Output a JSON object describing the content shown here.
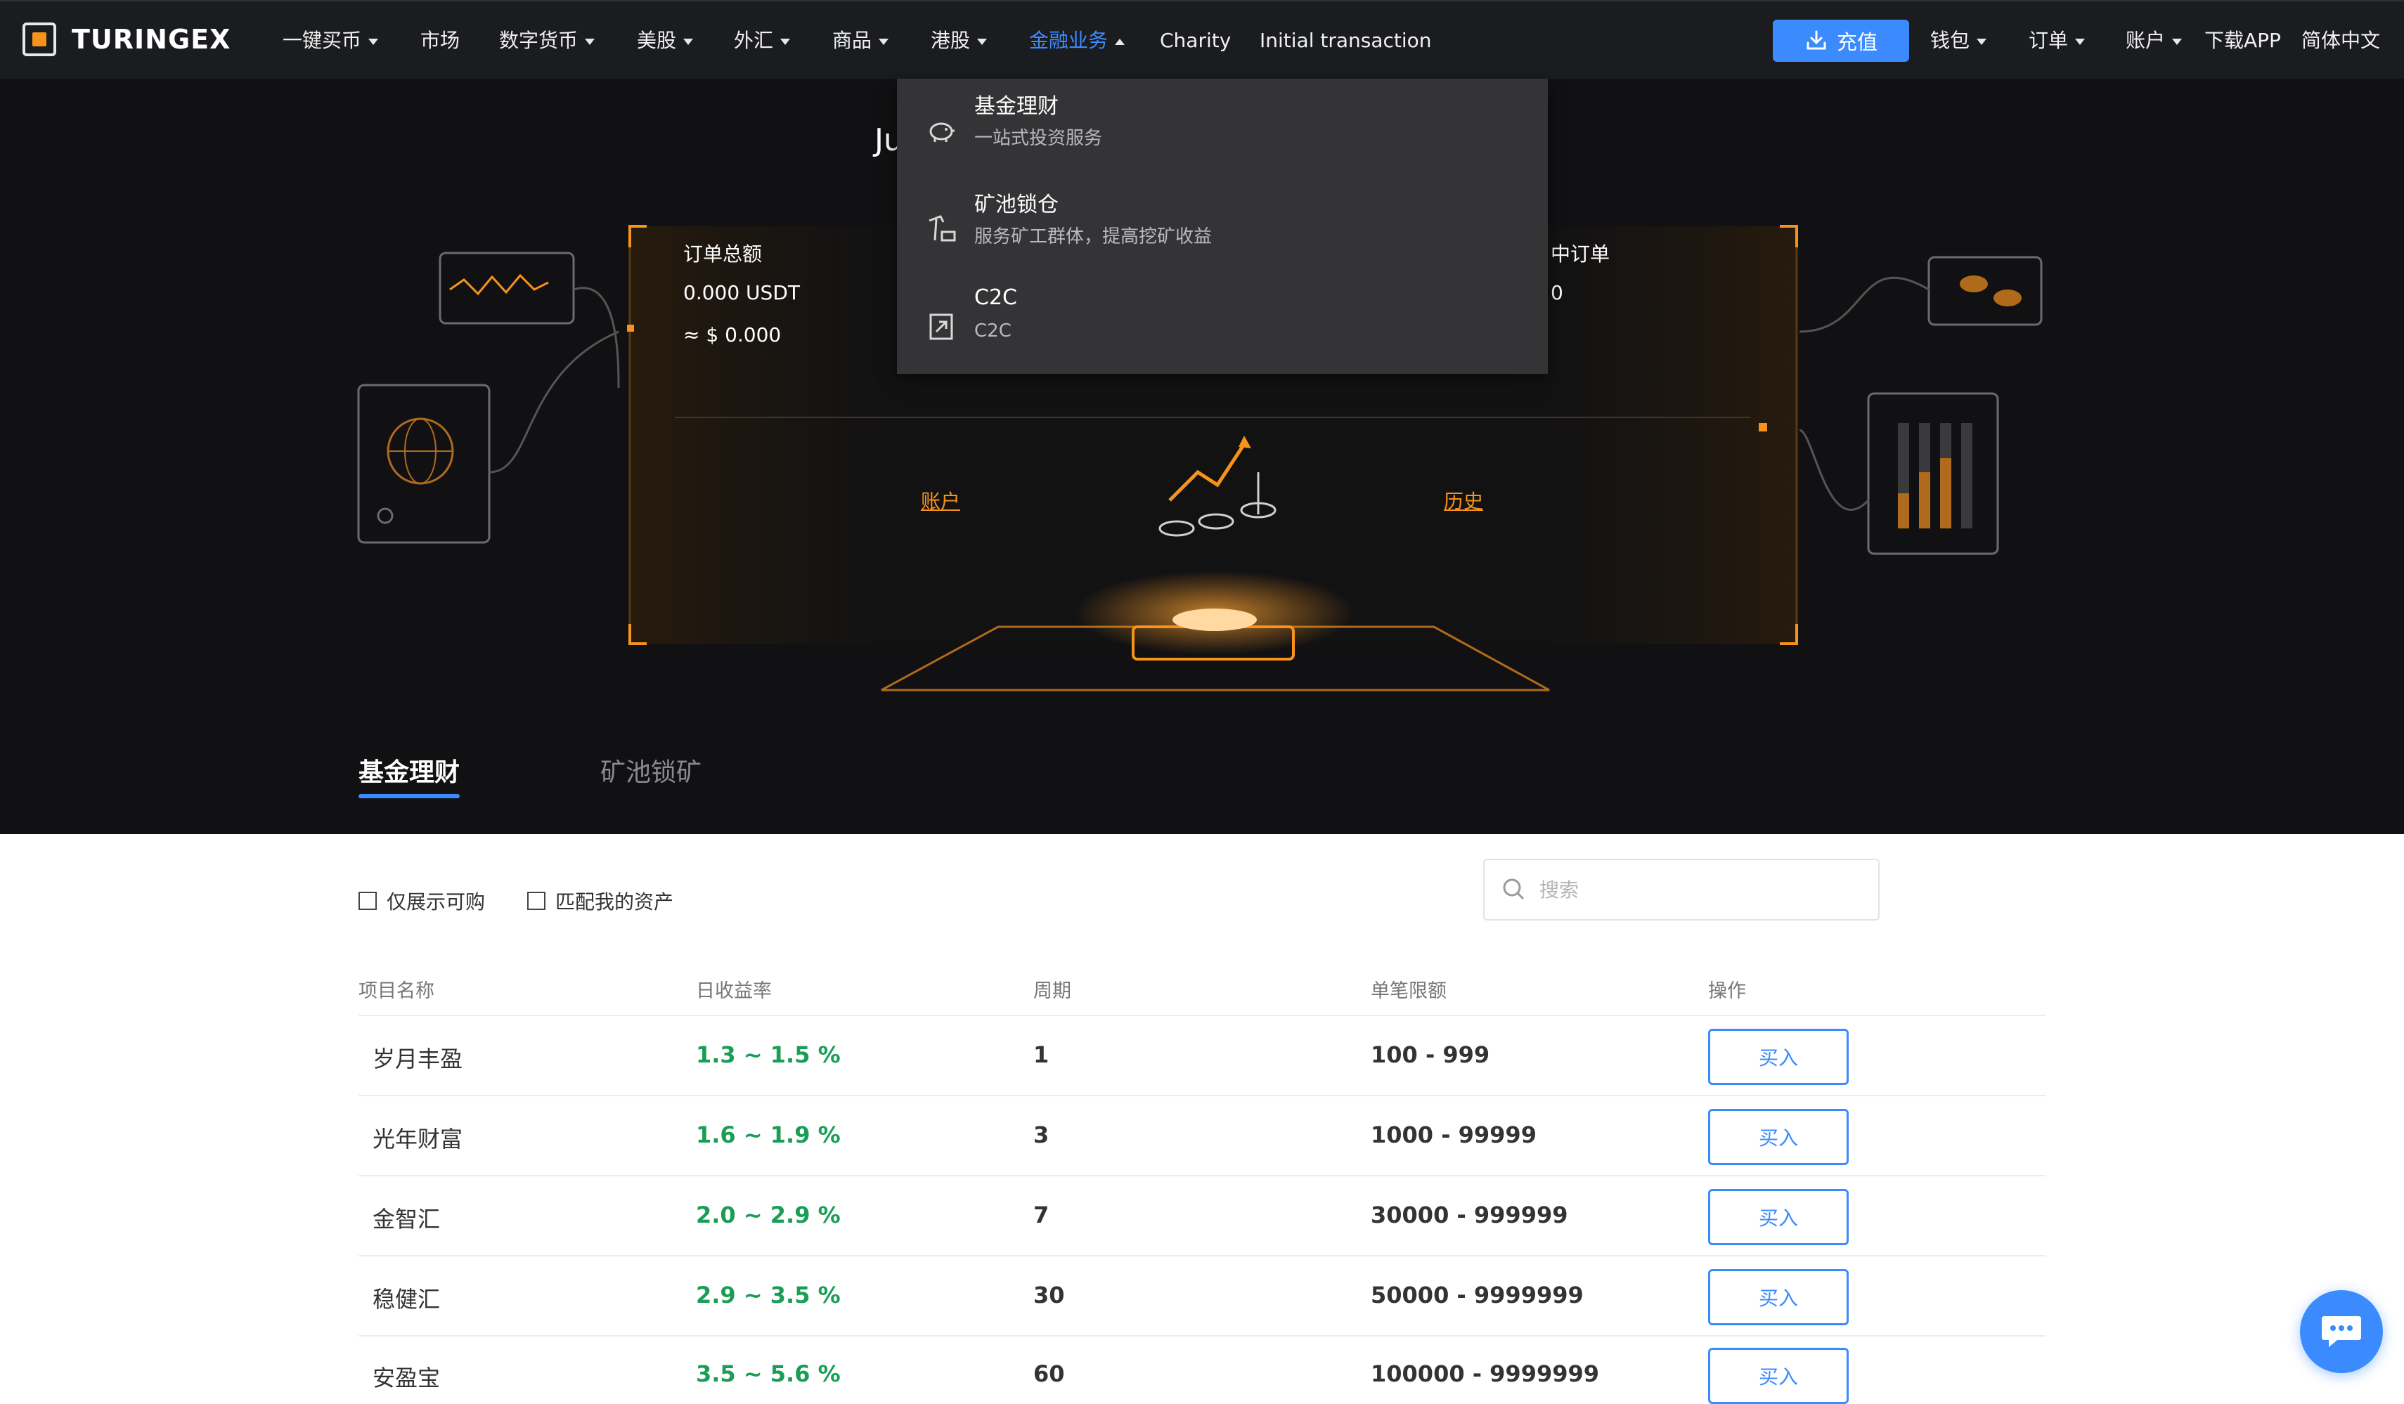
{
  "brand": {
    "name": "TURINGEX"
  },
  "nav": {
    "items": [
      {
        "label": "一键买币",
        "caret": true
      },
      {
        "label": "市场",
        "caret": false
      },
      {
        "label": "数字货币",
        "caret": true
      },
      {
        "label": "美股",
        "caret": true
      },
      {
        "label": "外汇",
        "caret": true
      },
      {
        "label": "商品",
        "caret": true
      },
      {
        "label": "港股",
        "caret": true
      },
      {
        "label": "金融业务",
        "caret": true,
        "active": true
      },
      {
        "label": "Charity",
        "caret": false
      },
      {
        "label": "Initial transaction",
        "caret": false
      }
    ],
    "deposit_label": "充值",
    "right": [
      {
        "label": "钱包",
        "caret": true
      },
      {
        "label": "订单",
        "caret": true
      },
      {
        "label": "账户",
        "caret": true
      },
      {
        "label": "下载APP",
        "caret": false
      },
      {
        "label": "简体中文",
        "caret": false
      }
    ]
  },
  "dropdown": {
    "items": [
      {
        "title": "基金理财",
        "subtitle": "一站式投资服务",
        "icon": "piggy-bank-icon"
      },
      {
        "title": "矿池锁仓",
        "subtitle": "服务矿工群体，提高挖矿收益",
        "icon": "mining-cart-icon"
      },
      {
        "title": "C2C",
        "subtitle": "C2C",
        "icon": "c2c-document-icon"
      }
    ]
  },
  "hero": {
    "title_fragment": "Ju",
    "orders_total_label": "订单总额",
    "orders_total_usdt": "0.000 USDT",
    "orders_total_usd": "≈ $ 0.000",
    "right_label_fragment": "中订单",
    "right_value_fragment": "0",
    "account_link": "账户",
    "history_link": "历史"
  },
  "tabs": [
    {
      "label": "基金理财",
      "active": true
    },
    {
      "label": "矿池锁矿",
      "active": false
    }
  ],
  "filters": {
    "only_buyable": "仅展示可购",
    "match_assets": "匹配我的资产",
    "search_placeholder": "搜索"
  },
  "table": {
    "headers": [
      "项目名称",
      "日收益率",
      "周期",
      "单笔限额",
      "操作"
    ],
    "rows": [
      {
        "name": "岁月丰盈",
        "rate": "1.3 ~ 1.5 %",
        "cycle": "1",
        "limit": "100 - 999",
        "action": "买入"
      },
      {
        "name": "光年财富",
        "rate": "1.6 ~ 1.9 %",
        "cycle": "3",
        "limit": "1000 - 99999",
        "action": "买入"
      },
      {
        "name": "金智汇",
        "rate": "2.0 ~ 2.9 %",
        "cycle": "7",
        "limit": "30000 - 999999",
        "action": "买入"
      },
      {
        "name": "稳健汇",
        "rate": "2.9 ~ 3.5 %",
        "cycle": "30",
        "limit": "50000 - 9999999",
        "action": "买入"
      },
      {
        "name": "安盈宝",
        "rate": "3.5 ~ 5.6 %",
        "cycle": "60",
        "limit": "100000 - 9999999",
        "action": "买入"
      }
    ]
  },
  "colors": {
    "accent": "#3b8bff",
    "orange": "#f7931a",
    "green": "#1a9e55",
    "nav_bg": "#1b1c1f",
    "hero_bg": "#111113"
  }
}
